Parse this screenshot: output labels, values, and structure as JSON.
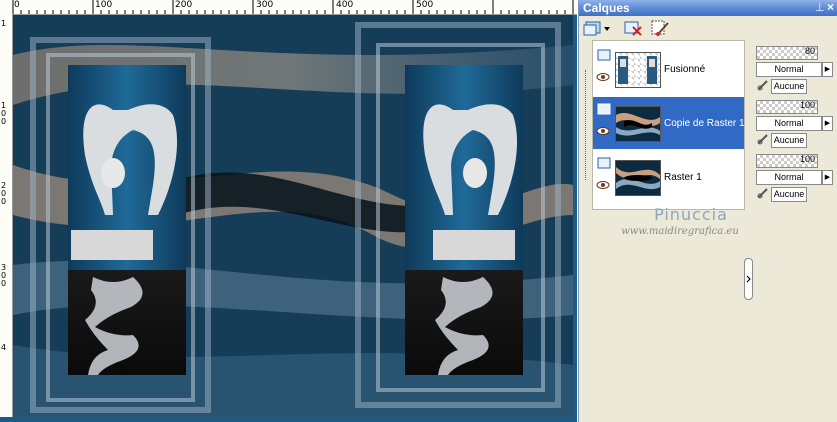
{
  "ruler": {
    "top_labels": [
      "0",
      "100",
      "200",
      "300",
      "400",
      "500"
    ],
    "left_labels": [
      "1",
      "1 0 0",
      "2 0 0",
      "3 0 0",
      "4"
    ]
  },
  "panel": {
    "title": "Calques",
    "pin_icon": "pin-icon",
    "close_icon": "close-icon"
  },
  "toolbar": {
    "icons": [
      "new-layer-icon",
      "delete-layer-icon",
      "layer-properties-icon"
    ]
  },
  "layers": [
    {
      "name": "Fusionné",
      "opacity": "80",
      "blend": "Normal",
      "mask": "Aucune",
      "selected": false
    },
    {
      "name": "Copie de Raster 1",
      "opacity": "100",
      "blend": "Normal",
      "mask": "Aucune",
      "selected": true
    },
    {
      "name": "Raster 1",
      "opacity": "100",
      "blend": "Normal",
      "mask": "Aucune",
      "selected": false
    }
  ],
  "watermark": {
    "name": "Pinuccia",
    "url": "www.maidiregrafica.eu"
  },
  "colors": {
    "panel_bg": "#ece9d8",
    "header_blue": "#5d8cd6",
    "selection": "#316ac5",
    "canvas_dark": "#0d2b40"
  }
}
